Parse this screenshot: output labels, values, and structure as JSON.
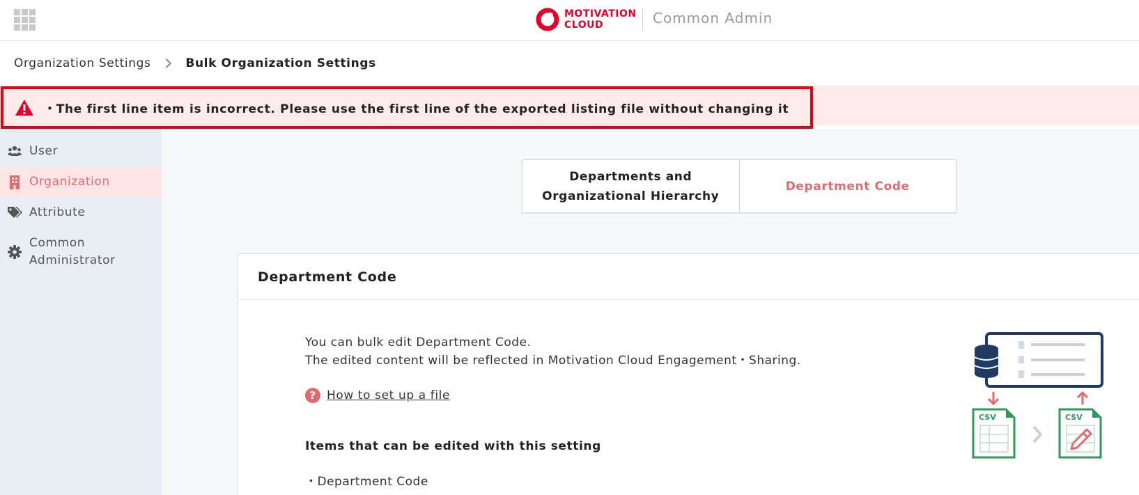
{
  "header": {
    "logo_line1": "MOTIVATION",
    "logo_line2": "CLOUD",
    "app_name": "Common Admin"
  },
  "breadcrumb": {
    "parent": "Organization Settings",
    "current": "Bulk Organization Settings"
  },
  "alert": {
    "message": "・The first line item is incorrect. Please use the first line of the exported listing file without changing it"
  },
  "sidebar": {
    "items": [
      {
        "label": "User",
        "icon": "users-icon"
      },
      {
        "label": "Organization",
        "icon": "building-icon",
        "active": true
      },
      {
        "label": "Attribute",
        "icon": "tags-icon"
      },
      {
        "label": "Common Administrator",
        "icon": "gear-icon"
      }
    ]
  },
  "tabs": [
    {
      "label": "Departments and Organizational Hierarchy",
      "active": false
    },
    {
      "label": "Department Code",
      "active": true
    }
  ],
  "card": {
    "title": "Department Code",
    "desc_line1": "You can bulk edit Department Code.",
    "desc_line2": "The edited content will be reflected in Motivation Cloud Engagement・Sharing.",
    "howto_label": "How to set up a file",
    "items_title": "Items that can be edited with this setting",
    "items": [
      "・Department Code"
    ],
    "csv_label": "CSV"
  },
  "colors": {
    "brand": "#e4002b",
    "accent": "#e06a6d",
    "alert_border": "#e60012",
    "alert_bg": "#fdeaeb",
    "sidebar_bg": "#e9edf4",
    "csv_green": "#2e9a5a",
    "db_navy": "#1f3b63"
  }
}
